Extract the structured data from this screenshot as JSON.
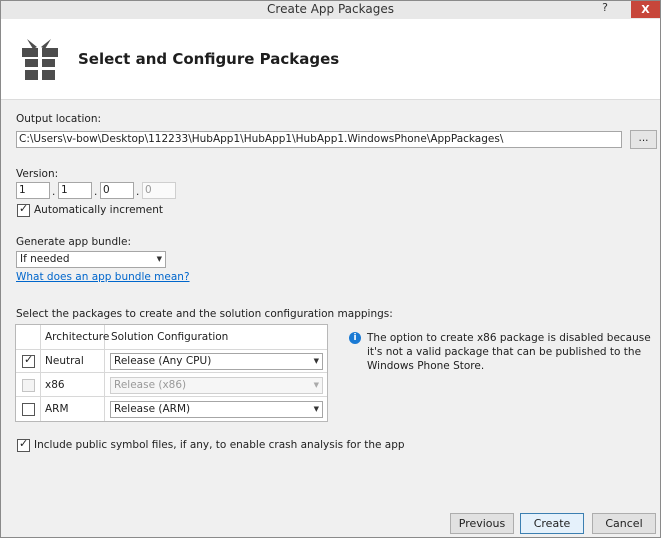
{
  "window": {
    "title": "Create App Packages",
    "help_glyph": "?",
    "close_glyph": "X"
  },
  "header": {
    "title": "Select and Configure Packages",
    "icon": "gift-package-icon"
  },
  "output": {
    "label": "Output location:",
    "path": "C:\\Users\\v-bow\\Desktop\\112233\\HubApp1\\HubApp1\\HubApp1.WindowsPhone\\AppPackages\\",
    "browse_label": "..."
  },
  "version": {
    "label": "Version:",
    "parts": [
      "1",
      "1",
      "0",
      "0"
    ],
    "dot": ".",
    "auto_increment_label": "Automatically increment"
  },
  "bundle": {
    "label": "Generate app bundle:",
    "selected": "If needed",
    "link": "What does an app bundle mean?"
  },
  "packages": {
    "label": "Select the packages to create and the solution configuration mappings:",
    "headers": [
      "Architecture",
      "Solution Configuration"
    ],
    "rows": [
      {
        "arch": "Neutral",
        "config": "Release (Any CPU)",
        "checked": true,
        "enabled": true
      },
      {
        "arch": "x86",
        "config": "Release (x86)",
        "checked": false,
        "enabled": false
      },
      {
        "arch": "ARM",
        "config": "Release (ARM)",
        "checked": false,
        "enabled": true
      }
    ],
    "check_glyph": "✓"
  },
  "info": {
    "icon_glyph": "i",
    "text": "The option to create x86 package is disabled because it's not a valid package that can be published to the Windows Phone Store."
  },
  "symbols": {
    "label": "Include public symbol files, if any, to enable crash analysis for the app"
  },
  "footer": {
    "previous": "Previous",
    "create": "Create",
    "cancel": "Cancel"
  },
  "colors": {
    "link": "#0066cc",
    "info": "#1a7ad4",
    "close": "#c7463a",
    "primary_border": "#3c7fb1"
  }
}
